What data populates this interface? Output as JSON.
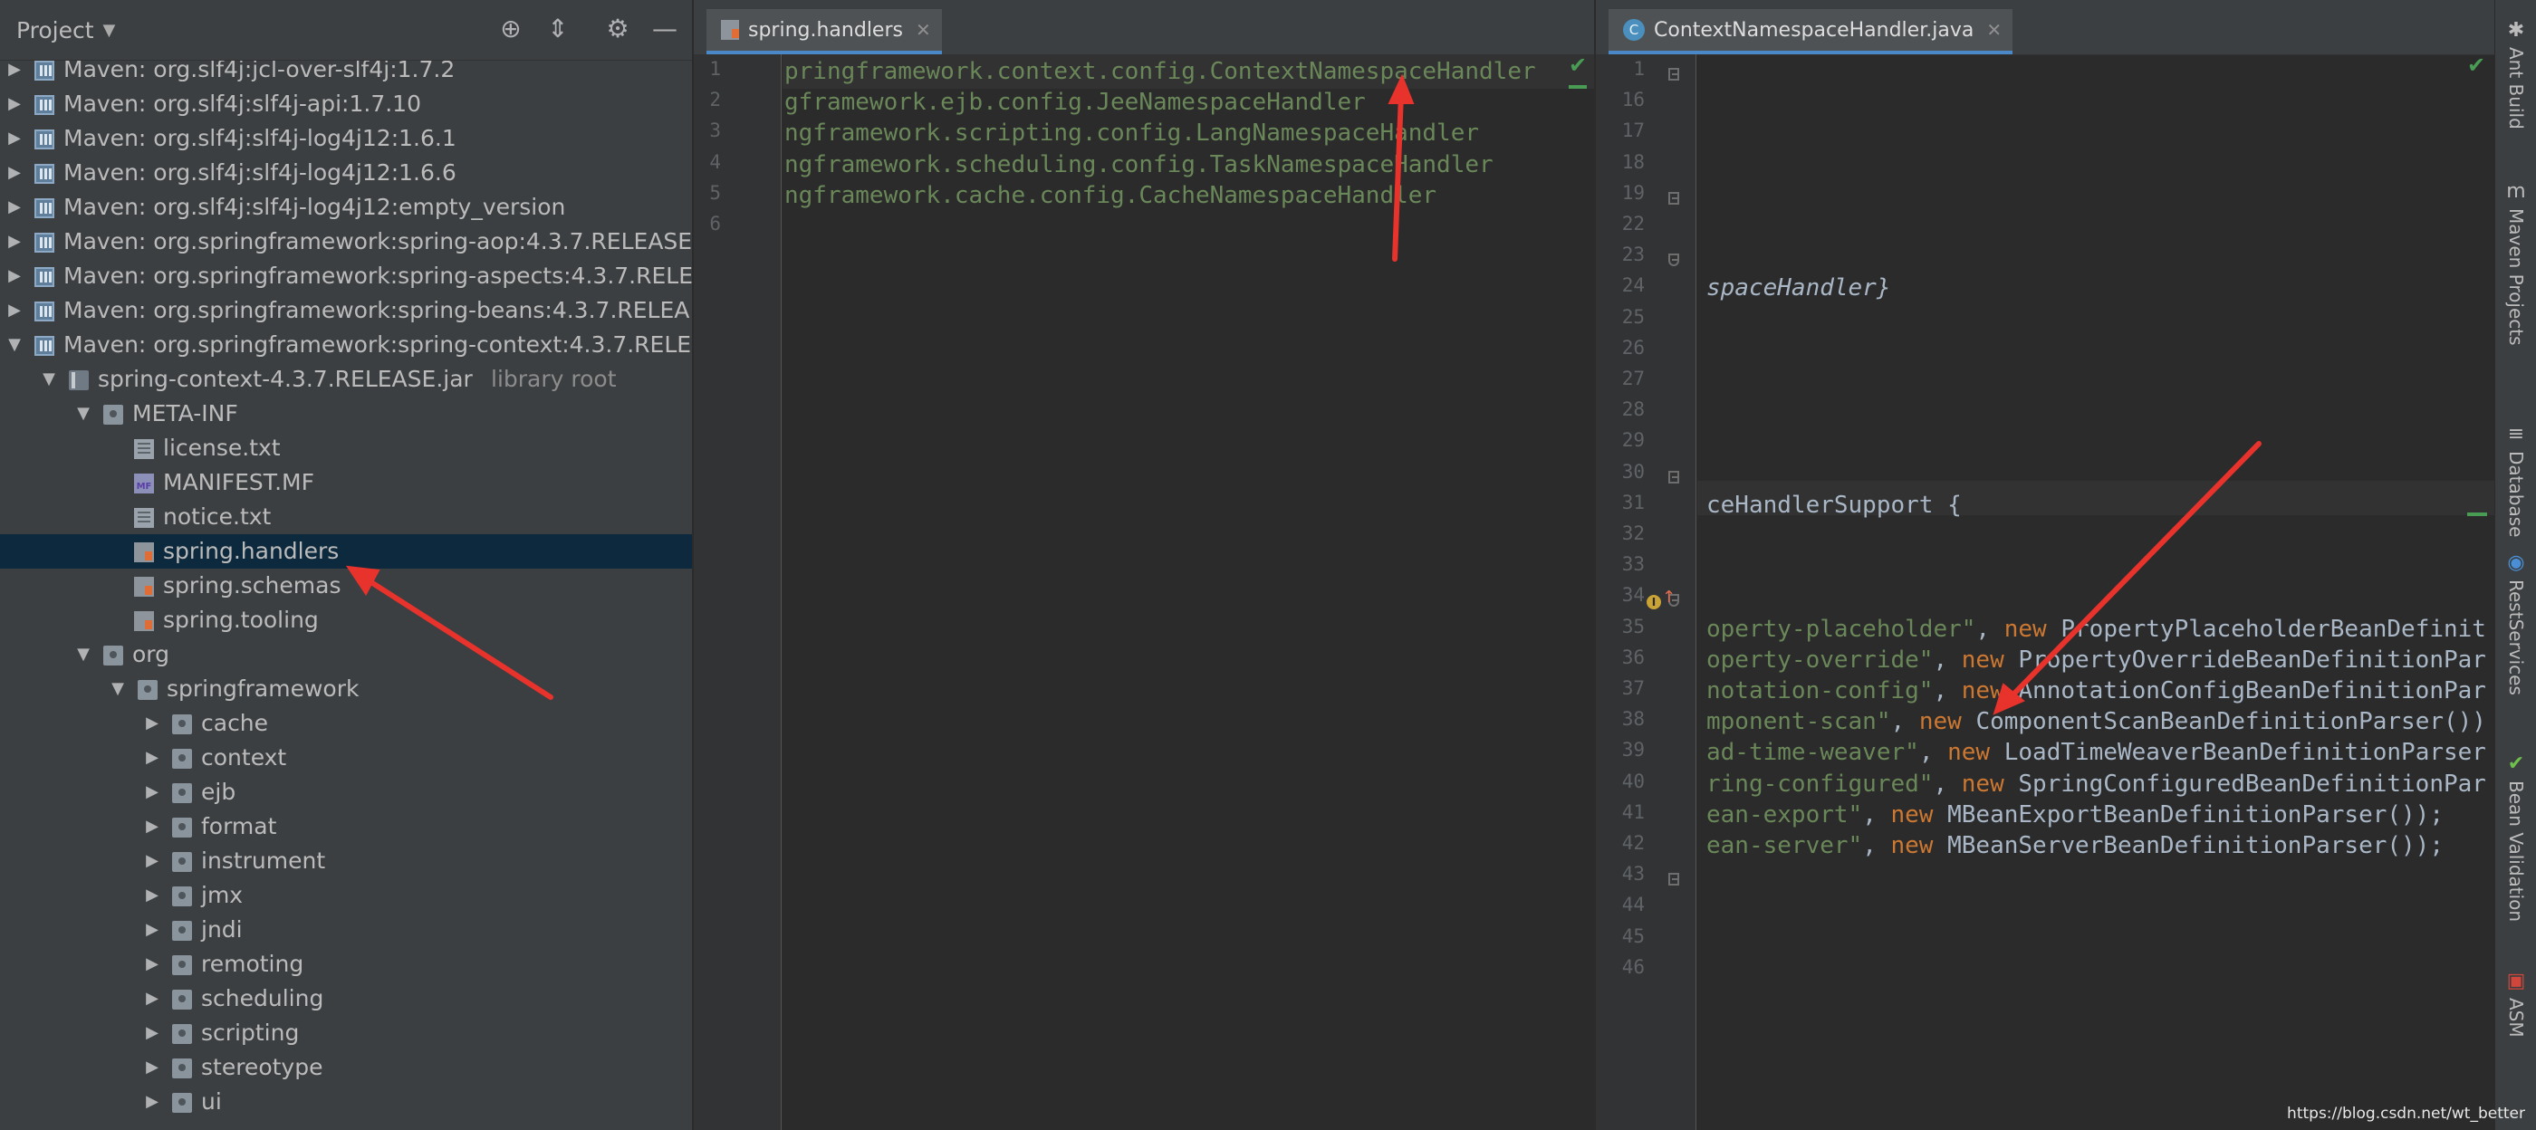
{
  "project_panel": {
    "title": "Project",
    "tree": [
      {
        "indent": 0,
        "arrow": "▶",
        "icon": "maven",
        "label": "Maven: org.slf4j:jcl-over-slf4j:1.7.2"
      },
      {
        "indent": 0,
        "arrow": "▶",
        "icon": "maven",
        "label": "Maven: org.slf4j:slf4j-api:1.7.10"
      },
      {
        "indent": 0,
        "arrow": "▶",
        "icon": "maven",
        "label": "Maven: org.slf4j:slf4j-log4j12:1.6.1"
      },
      {
        "indent": 0,
        "arrow": "▶",
        "icon": "maven",
        "label": "Maven: org.slf4j:slf4j-log4j12:1.6.6"
      },
      {
        "indent": 0,
        "arrow": "▶",
        "icon": "maven",
        "label": "Maven: org.slf4j:slf4j-log4j12:empty_version"
      },
      {
        "indent": 0,
        "arrow": "▶",
        "icon": "maven",
        "label": "Maven: org.springframework:spring-aop:4.3.7.RELEASE"
      },
      {
        "indent": 0,
        "arrow": "▶",
        "icon": "maven",
        "label": "Maven: org.springframework:spring-aspects:4.3.7.RELE"
      },
      {
        "indent": 0,
        "arrow": "▶",
        "icon": "maven",
        "label": "Maven: org.springframework:spring-beans:4.3.7.RELEA"
      },
      {
        "indent": 0,
        "arrow": "▼",
        "icon": "maven",
        "label": "Maven: org.springframework:spring-context:4.3.7.RELE"
      },
      {
        "indent": 1,
        "arrow": "▼",
        "icon": "jar",
        "label": "spring-context-4.3.7.RELEASE.jar",
        "suffix": "library root"
      },
      {
        "indent": 2,
        "arrow": "▼",
        "icon": "folder",
        "label": "META-INF"
      },
      {
        "indent": 3,
        "arrow": "",
        "icon": "file",
        "label": "license.txt"
      },
      {
        "indent": 3,
        "arrow": "",
        "icon": "mf",
        "label": "MANIFEST.MF"
      },
      {
        "indent": 3,
        "arrow": "",
        "icon": "file",
        "label": "notice.txt"
      },
      {
        "indent": 3,
        "arrow": "",
        "icon": "prop",
        "label": "spring.handlers",
        "selected": true
      },
      {
        "indent": 3,
        "arrow": "",
        "icon": "prop",
        "label": "spring.schemas"
      },
      {
        "indent": 3,
        "arrow": "",
        "icon": "prop",
        "label": "spring.tooling"
      },
      {
        "indent": 2,
        "arrow": "▼",
        "icon": "folder",
        "label": "org"
      },
      {
        "indent": 3,
        "arrow": "▼",
        "icon": "folder",
        "label": "springframework"
      },
      {
        "indent": 4,
        "arrow": "▶",
        "icon": "folder",
        "label": "cache"
      },
      {
        "indent": 4,
        "arrow": "▶",
        "icon": "folder",
        "label": "context"
      },
      {
        "indent": 4,
        "arrow": "▶",
        "icon": "folder",
        "label": "ejb"
      },
      {
        "indent": 4,
        "arrow": "▶",
        "icon": "folder",
        "label": "format"
      },
      {
        "indent": 4,
        "arrow": "▶",
        "icon": "folder",
        "label": "instrument"
      },
      {
        "indent": 4,
        "arrow": "▶",
        "icon": "folder",
        "label": "jmx"
      },
      {
        "indent": 4,
        "arrow": "▶",
        "icon": "folder",
        "label": "jndi"
      },
      {
        "indent": 4,
        "arrow": "▶",
        "icon": "folder",
        "label": "remoting"
      },
      {
        "indent": 4,
        "arrow": "▶",
        "icon": "folder",
        "label": "scheduling"
      },
      {
        "indent": 4,
        "arrow": "▶",
        "icon": "folder",
        "label": "scripting"
      },
      {
        "indent": 4,
        "arrow": "▶",
        "icon": "folder",
        "label": "stereotype"
      },
      {
        "indent": 4,
        "arrow": "▶",
        "icon": "folder",
        "label": "ui"
      }
    ]
  },
  "editor_left": {
    "tab_label": "spring.handlers",
    "lines": [
      {
        "num": "1",
        "text": "pringframework.context.config.ContextNamespaceHandler"
      },
      {
        "num": "2",
        "text": "gframework.ejb.config.JeeNamespaceHandler"
      },
      {
        "num": "3",
        "text": "ngframework.scripting.config.LangNamespaceHandler"
      },
      {
        "num": "4",
        "text": "ngframework.scheduling.config.TaskNamespaceHandler"
      },
      {
        "num": "5",
        "text": "ngframework.cache.config.CacheNamespaceHandler"
      },
      {
        "num": "6",
        "text": ""
      }
    ]
  },
  "editor_right": {
    "tab_label": "ContextNamespaceHandler.java",
    "line_numbers": [
      "1",
      "16",
      "17",
      "18",
      "19",
      "22",
      "23",
      "24",
      "25",
      "26",
      "27",
      "28",
      "29",
      "30",
      "31",
      "32",
      "33",
      "34",
      "35",
      "36",
      "37",
      "38",
      "39",
      "40",
      "41",
      "42",
      "43",
      "44",
      "45",
      "46"
    ],
    "code": {
      "l24": "spaceHandler}",
      "l31": "ceHandlerSupport {",
      "l35": [
        {
          "t": "operty-placeholder\"",
          "c": "str"
        },
        {
          "t": ", ",
          "c": "plain"
        },
        {
          "t": "new ",
          "c": "kw"
        },
        {
          "t": "PropertyPlaceholderBeanDefinit",
          "c": "plain"
        }
      ],
      "l36": [
        {
          "t": "operty-override\"",
          "c": "str"
        },
        {
          "t": ", ",
          "c": "plain"
        },
        {
          "t": "new ",
          "c": "kw"
        },
        {
          "t": "PropertyOverrideBeanDefinitionPar",
          "c": "plain"
        }
      ],
      "l37": [
        {
          "t": "notation-config\"",
          "c": "str"
        },
        {
          "t": ", ",
          "c": "plain"
        },
        {
          "t": "new ",
          "c": "kw"
        },
        {
          "t": "AnnotationConfigBeanDefinitionPar",
          "c": "plain"
        }
      ],
      "l38": [
        {
          "t": "mponent-scan\"",
          "c": "str"
        },
        {
          "t": ", ",
          "c": "plain"
        },
        {
          "t": "new ",
          "c": "kw"
        },
        {
          "t": "ComponentScanBeanDefinitionParser())",
          "c": "plain"
        }
      ],
      "l39": [
        {
          "t": "ad-time-weaver\"",
          "c": "str"
        },
        {
          "t": ", ",
          "c": "plain"
        },
        {
          "t": "new ",
          "c": "kw"
        },
        {
          "t": "LoadTimeWeaverBeanDefinitionParser",
          "c": "plain"
        }
      ],
      "l40": [
        {
          "t": "ring-configured\"",
          "c": "str"
        },
        {
          "t": ", ",
          "c": "plain"
        },
        {
          "t": "new ",
          "c": "kw"
        },
        {
          "t": "SpringConfiguredBeanDefinitionPar",
          "c": "plain"
        }
      ],
      "l41": [
        {
          "t": "ean-export\"",
          "c": "str"
        },
        {
          "t": ", ",
          "c": "plain"
        },
        {
          "t": "new ",
          "c": "kw"
        },
        {
          "t": "MBeanExportBeanDefinitionParser());",
          "c": "plain"
        }
      ],
      "l42": [
        {
          "t": "ean-server\"",
          "c": "str"
        },
        {
          "t": ", ",
          "c": "plain"
        },
        {
          "t": "new ",
          "c": "kw"
        },
        {
          "t": "MBeanServerBeanDefinitionParser());",
          "c": "plain"
        }
      ]
    }
  },
  "tool_strip": [
    {
      "name": "ant-build",
      "label": "Ant Build",
      "icon": "ant-icon"
    },
    {
      "name": "maven-projects",
      "label": "Maven Projects",
      "icon": "maven-m-icon"
    },
    {
      "name": "database",
      "label": "Database",
      "icon": "database-icon"
    },
    {
      "name": "rest-services",
      "label": "RestServices",
      "icon": "globe-icon"
    },
    {
      "name": "bean-validation",
      "label": "Bean Validation",
      "icon": "bean-check-icon"
    },
    {
      "name": "asm",
      "label": "ASM",
      "icon": "asm-icon"
    }
  ],
  "watermark": "https://blog.csdn.net/wt_better",
  "colors": {
    "background": "#2b2b2b",
    "panel": "#3c3f41",
    "selection": "#0d293e",
    "string": "#6a8759",
    "keyword": "#cc7832",
    "annotation_arrow": "#e8322c"
  }
}
